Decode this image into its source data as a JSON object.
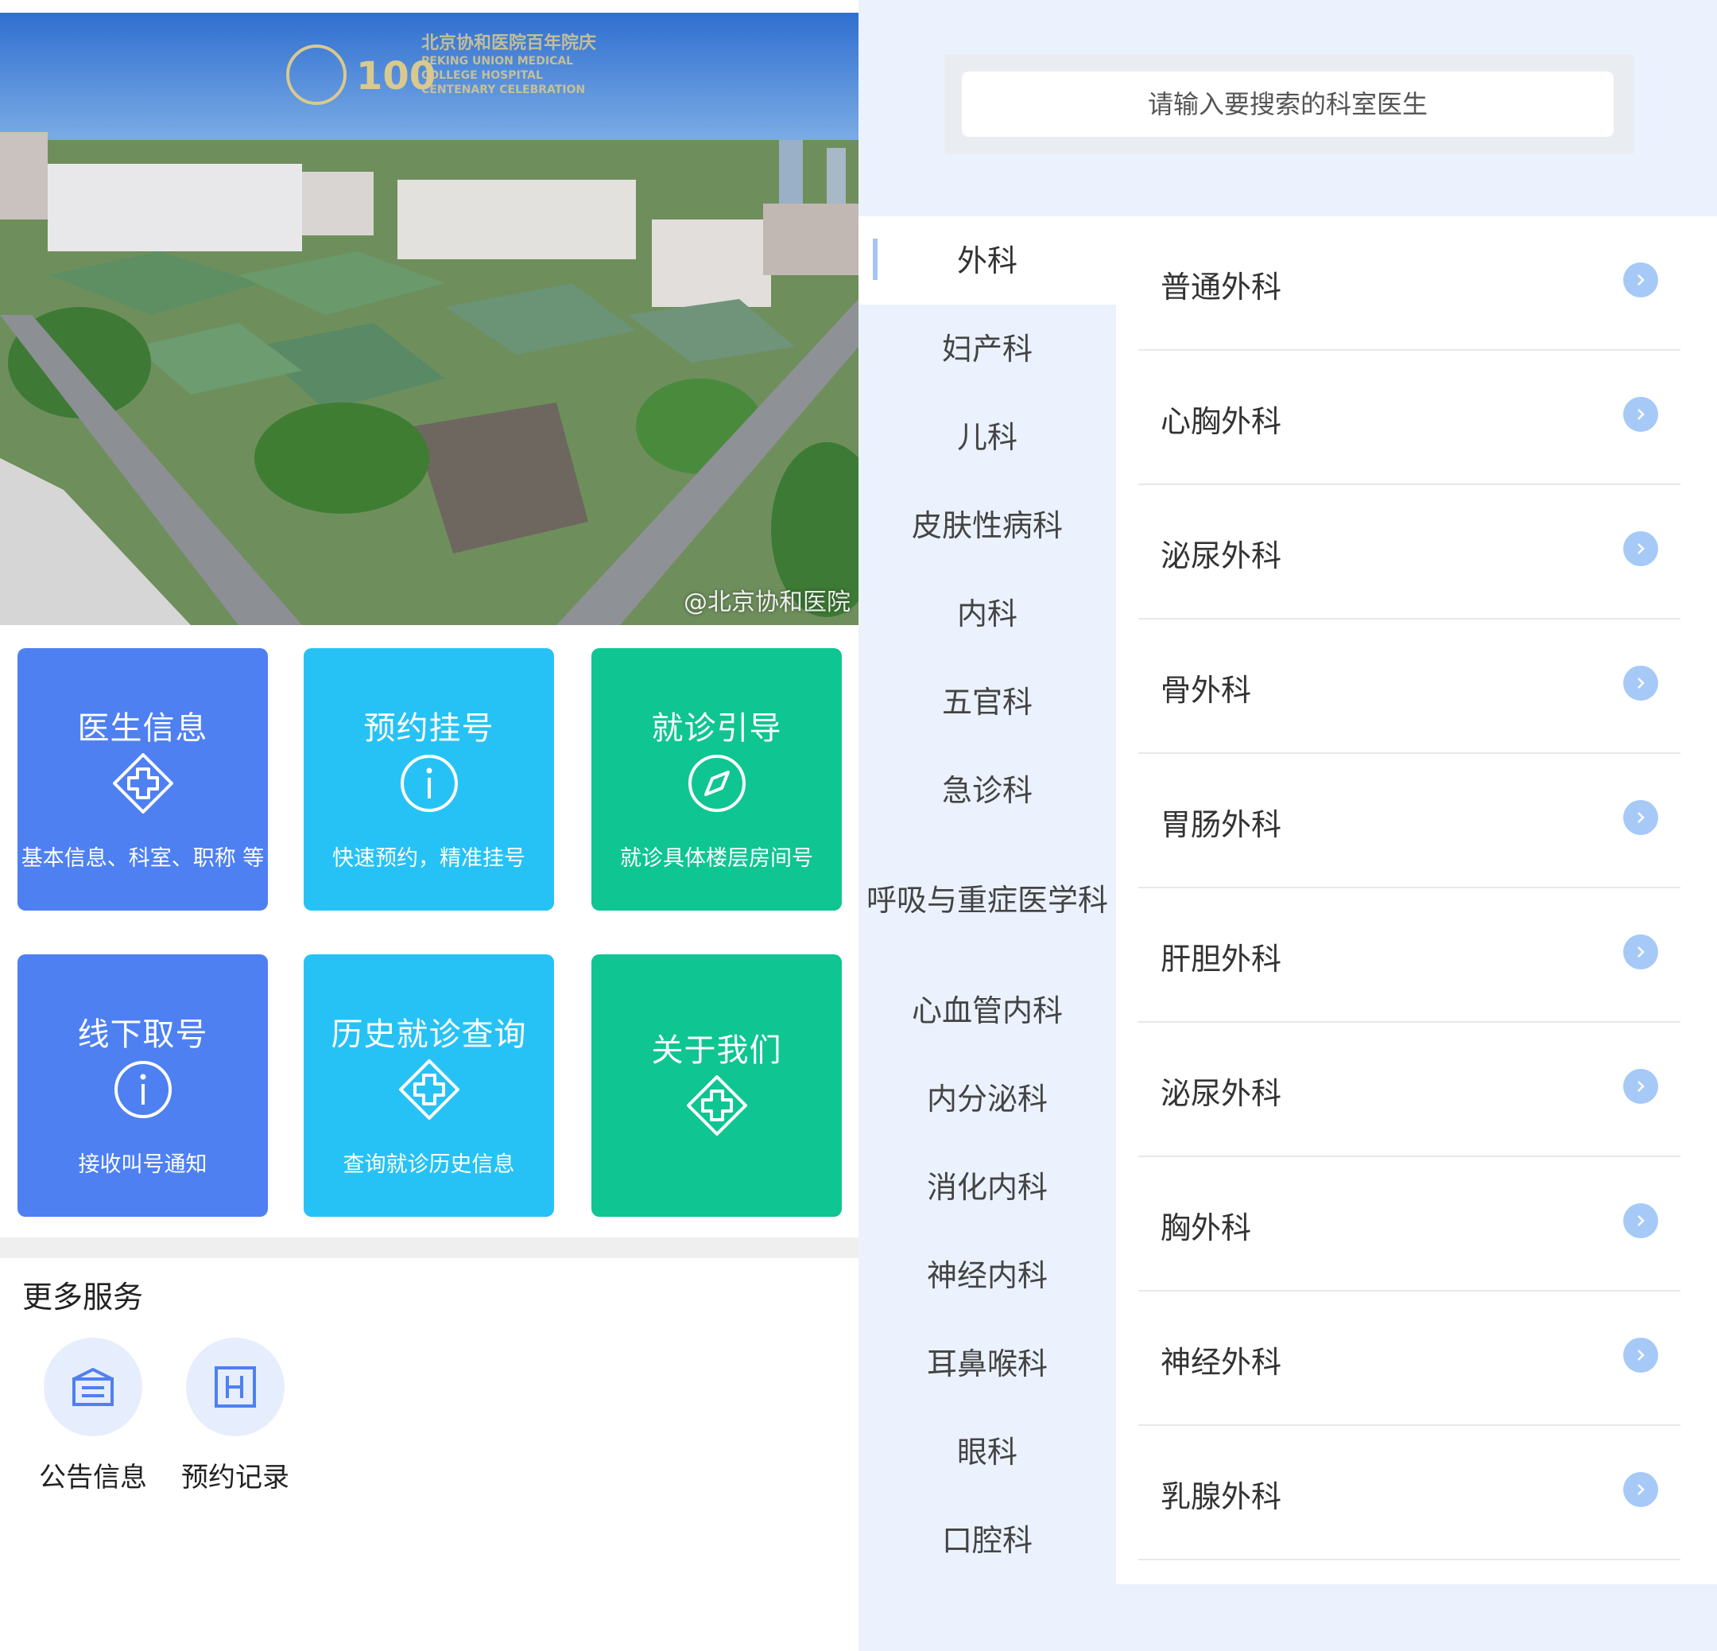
{
  "left": {
    "banner": {
      "watermark": "@北京协和医院",
      "logo_lines": [
        "北京协和医院百年院庆",
        "PEKING UNION MEDICAL",
        "COLLEGE HOSPITAL",
        "CENTENARY CELEBRATION"
      ],
      "logo_badge": "100"
    },
    "tiles": [
      {
        "title": "医生信息",
        "subtitle": "基本信息、科室、职称 等",
        "icon": "medical-cross-icon",
        "color": "#4e80f2"
      },
      {
        "title": "预约挂号",
        "subtitle": "快速预约，精准挂号",
        "icon": "info-icon",
        "color": "#27c2f5"
      },
      {
        "title": "就诊引导",
        "subtitle": "就诊具体楼层房间号",
        "icon": "compass-icon",
        "color": "#0fc592"
      },
      {
        "title": "线下取号",
        "subtitle": "接收叫号通知",
        "icon": "info-icon",
        "color": "#4e80f2"
      },
      {
        "title": "历史就诊查询",
        "subtitle": "查询就诊历史信息",
        "icon": "medical-cross-icon",
        "color": "#27c2f5"
      },
      {
        "title": "关于我们",
        "subtitle": "",
        "icon": "medical-cross-icon",
        "color": "#0fc592"
      }
    ],
    "more_services": {
      "title": "更多服务",
      "items": [
        {
          "label": "公告信息",
          "icon": "announcement-icon"
        },
        {
          "label": "预约记录",
          "icon": "hospital-record-icon"
        }
      ]
    }
  },
  "right": {
    "search": {
      "placeholder": "请输入要搜索的科室医生"
    },
    "categories": [
      "外科",
      "妇产科",
      "儿科",
      "皮肤性病科",
      "内科",
      "五官科",
      "急诊科",
      "呼吸与重症医学科",
      "心血管内科",
      "内分泌科",
      "消化内科",
      "神经内科",
      "耳鼻喉科",
      "眼科",
      "口腔科"
    ],
    "active_category": "外科",
    "departments": [
      "普通外科",
      "心胸外科",
      "泌尿外科",
      "骨外科",
      "胃肠外科",
      "肝胆外科",
      "泌尿外科",
      "胸外科",
      "神经外科",
      "乳腺外科"
    ]
  },
  "colors": {
    "accent_blue": "#4e80f2",
    "accent_cyan": "#27c2f5",
    "accent_green": "#0fc592",
    "arrow_blue": "#a6c9f7",
    "panel_bg": "#ebf2fd"
  }
}
